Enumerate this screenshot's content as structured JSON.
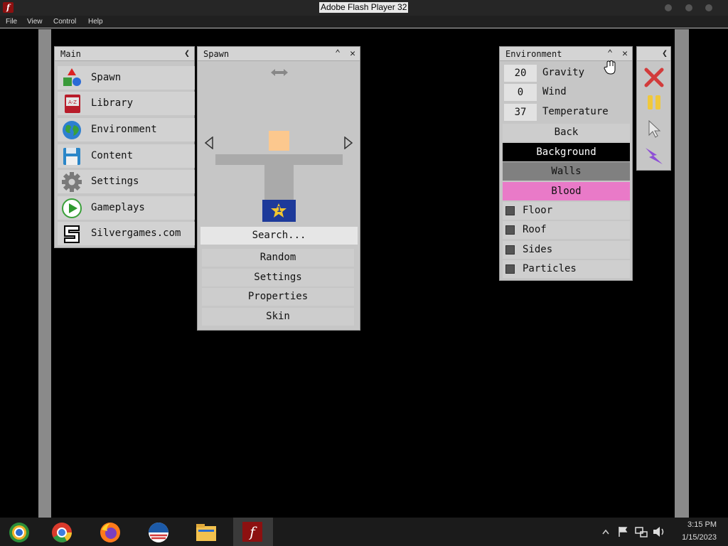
{
  "window": {
    "title": "Adobe Flash Player 32",
    "icon": "flash-icon"
  },
  "menubar": {
    "items": [
      "File",
      "View",
      "Control",
      "Help"
    ]
  },
  "main_panel": {
    "title": "Main",
    "items": [
      {
        "label": "Spawn",
        "icon": "shapes-icon"
      },
      {
        "label": "Library",
        "icon": "book-icon"
      },
      {
        "label": "Environment",
        "icon": "globe-icon"
      },
      {
        "label": "Content",
        "icon": "floppy-disk-icon"
      },
      {
        "label": "Settings",
        "icon": "gear-icon"
      },
      {
        "label": "Gameplays",
        "icon": "play-icon"
      },
      {
        "label": "Silvergames.com",
        "icon": "silvergames-logo-icon"
      }
    ]
  },
  "spawn_panel": {
    "title": "Spawn",
    "search_label": "Search...",
    "buttons": [
      "Random",
      "Settings",
      "Properties",
      "Skin"
    ],
    "badge_number": "1"
  },
  "environment_panel": {
    "title": "Environment",
    "fields": [
      {
        "value": "20",
        "label": "Gravity"
      },
      {
        "value": "0",
        "label": "Wind"
      },
      {
        "value": "37",
        "label": "Temperature"
      }
    ],
    "back_label": "Back",
    "color_options": [
      {
        "label": "Background",
        "bg": "#000000",
        "fg": "#ffffff"
      },
      {
        "label": "Walls",
        "bg": "#808080",
        "fg": "#111111"
      },
      {
        "label": "Blood",
        "bg": "#e97ac8",
        "fg": "#111111"
      }
    ],
    "toggles": [
      "Floor",
      "Roof",
      "Sides",
      "Particles"
    ]
  },
  "tools_panel": {
    "icons": [
      "close-x-icon",
      "pause-icon",
      "cursor-icon",
      "lightning-icon"
    ],
    "colors": {
      "close": "#d23b3b",
      "pause": "#f0c83c",
      "lightning": "#8e4fd6"
    }
  },
  "taskbar": {
    "apps": [
      "chrome-canary-icon",
      "chrome-icon",
      "firefox-icon",
      "opera-icon",
      "file-explorer-icon",
      "flash-player-icon"
    ],
    "time": "3:15 PM",
    "date": "1/15/2023"
  }
}
